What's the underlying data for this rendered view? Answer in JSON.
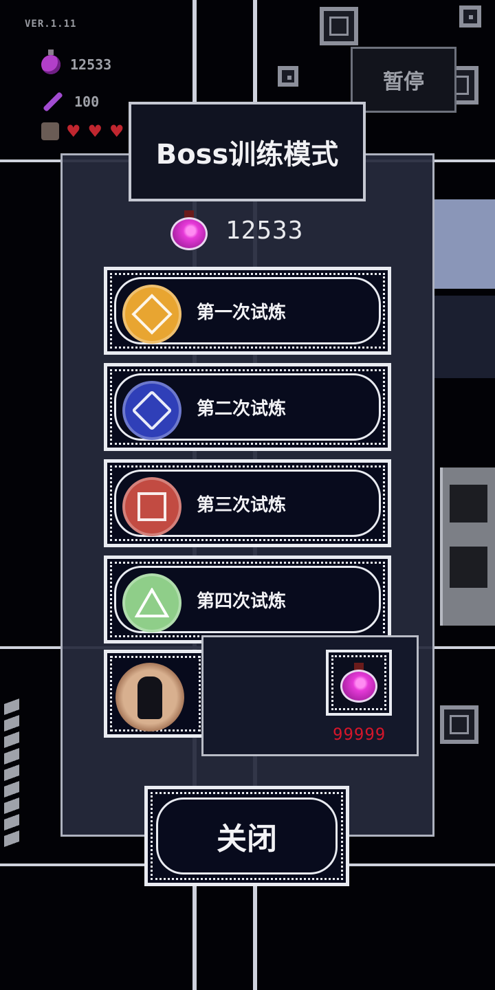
{
  "hud": {
    "version": "VER.1.11",
    "soul_count": "12533",
    "feather_count": "100",
    "hearts": [
      "heart",
      "heart",
      "heart"
    ]
  },
  "pause_label": "暂停",
  "modal": {
    "title": "Boss训练模式",
    "currency_value": "12533",
    "trials": [
      {
        "label": "第一次试炼",
        "medal_color": "#e8a531",
        "icon": "gold-seal-icon"
      },
      {
        "label": "第二次试炼",
        "medal_color": "#2f3fb8",
        "icon": "blue-seal-icon"
      },
      {
        "label": "第三次试炼",
        "medal_color": "#c24b42",
        "icon": "red-seal-icon"
      },
      {
        "label": "第四次试炼",
        "medal_color": "#8fce89",
        "icon": "green-seal-icon"
      }
    ],
    "fifth_trial_icon": "hooded-figure-portrait",
    "tooltip": {
      "icon": "potion-icon",
      "cost": "99999"
    },
    "close_label": "关闭"
  }
}
